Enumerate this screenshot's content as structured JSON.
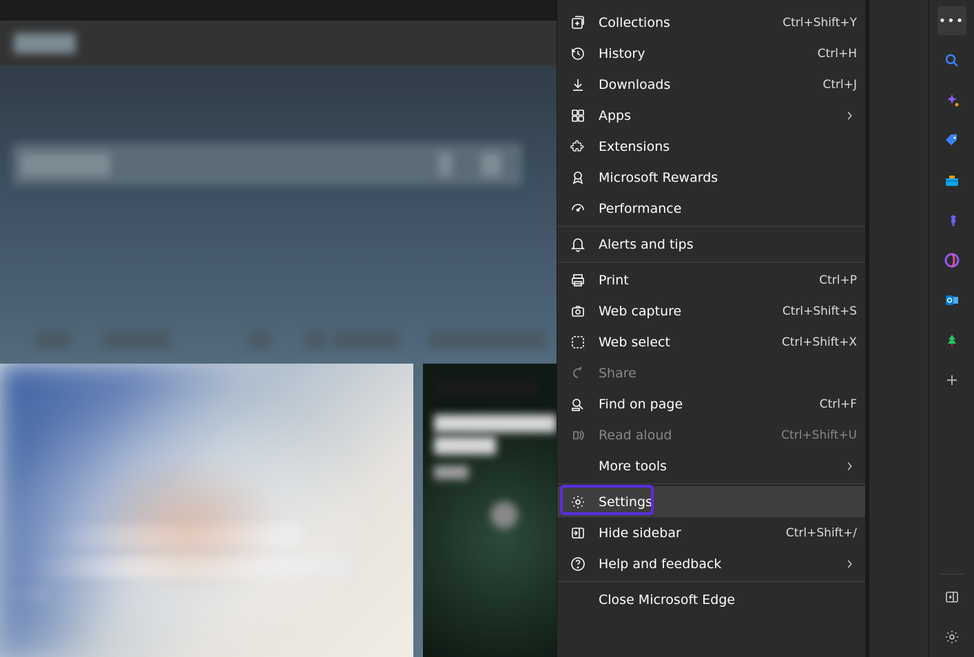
{
  "menu": {
    "items": [
      {
        "icon": "collections",
        "label": "Collections",
        "shortcut": "Ctrl+Shift+Y"
      },
      {
        "icon": "history",
        "label": "History",
        "shortcut": "Ctrl+H"
      },
      {
        "icon": "downloads",
        "label": "Downloads",
        "shortcut": "Ctrl+J"
      },
      {
        "icon": "apps",
        "label": "Apps",
        "chevron": true
      },
      {
        "icon": "extensions",
        "label": "Extensions"
      },
      {
        "icon": "rewards",
        "label": "Microsoft Rewards"
      },
      {
        "icon": "performance",
        "label": "Performance"
      }
    ],
    "items2": [
      {
        "icon": "bell",
        "label": "Alerts and tips"
      }
    ],
    "items3": [
      {
        "icon": "print",
        "label": "Print",
        "shortcut": "Ctrl+P"
      },
      {
        "icon": "capture",
        "label": "Web capture",
        "shortcut": "Ctrl+Shift+S"
      },
      {
        "icon": "select",
        "label": "Web select",
        "shortcut": "Ctrl+Shift+X"
      },
      {
        "icon": "share",
        "label": "Share",
        "disabled": true
      },
      {
        "icon": "find",
        "label": "Find on page",
        "shortcut": "Ctrl+F"
      },
      {
        "icon": "read",
        "label": "Read aloud",
        "shortcut": "Ctrl+Shift+U",
        "disabled": true
      },
      {
        "icon": "",
        "label": "More tools",
        "chevron": true
      }
    ],
    "items4": [
      {
        "icon": "settings",
        "label": "Settings",
        "highlighted": true
      },
      {
        "icon": "sidebar",
        "label": "Hide sidebar",
        "shortcut": "Ctrl+Shift+/"
      },
      {
        "icon": "help",
        "label": "Help and feedback",
        "chevron": true
      }
    ],
    "items5": [
      {
        "icon": "",
        "label": "Close Microsoft Edge"
      }
    ]
  },
  "sidebar_icons": [
    {
      "name": "more-menu",
      "kind": "dots"
    },
    {
      "name": "search",
      "kind": "search"
    },
    {
      "name": "ai-sparkle",
      "kind": "sparkle"
    },
    {
      "name": "shopping-tag",
      "kind": "tag"
    },
    {
      "name": "toolbox",
      "kind": "toolbox"
    },
    {
      "name": "games",
      "kind": "chess"
    },
    {
      "name": "m365",
      "kind": "m365"
    },
    {
      "name": "outlook",
      "kind": "outlook"
    },
    {
      "name": "tree",
      "kind": "tree"
    },
    {
      "name": "add",
      "kind": "plus"
    }
  ],
  "sidebar_bottom": [
    {
      "name": "panel-toggle",
      "kind": "panel"
    },
    {
      "name": "settings-gear",
      "kind": "gear"
    }
  ],
  "highlight_color": "#5b2de0"
}
